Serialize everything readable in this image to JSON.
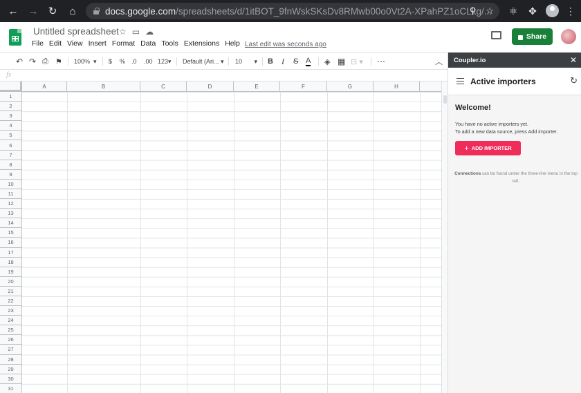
{
  "browser": {
    "url_host": "docs.google.com",
    "url_path": "/spreadsheets/d/1itBOT_9fnWskSKsDv8RMwb00o0Vt2A-XPahPZ1oCLkg/..."
  },
  "doc": {
    "title": "Untitled spreadsheet",
    "last_edit": "Last edit was seconds ago",
    "share_label": "Share"
  },
  "menu": [
    "File",
    "Edit",
    "View",
    "Insert",
    "Format",
    "Data",
    "Tools",
    "Extensions",
    "Help"
  ],
  "toolbar": {
    "zoom": "100%",
    "currency": "$",
    "percent": "%",
    "dec_decrease": ".0",
    "dec_increase": ".00",
    "number_format": "123",
    "font": "Default (Ari...",
    "font_size": "10",
    "bold": "B",
    "italic": "I",
    "strike": "S",
    "text_color": "A",
    "more": "⋯"
  },
  "formula_bar": {
    "fx": "fx"
  },
  "grid": {
    "columns": [
      "A",
      "B",
      "C",
      "D",
      "E",
      "F",
      "G",
      "H"
    ],
    "rows": [
      "1",
      "2",
      "3",
      "4",
      "5",
      "6",
      "7",
      "8",
      "9",
      "10",
      "11",
      "12",
      "13",
      "14",
      "15",
      "16",
      "17",
      "18",
      "19",
      "20",
      "21",
      "22",
      "23",
      "24",
      "25",
      "26",
      "27",
      "28",
      "29",
      "30",
      "31"
    ]
  },
  "panel": {
    "app_name": "Coupler.io",
    "close": "✕",
    "title": "Active importers",
    "welcome": "Welcome!",
    "message_line1": "You have no active importers yet.",
    "message_line2": "To add a new data source, press Add importer.",
    "add_button": "ADD IMPORTER",
    "hint_bold": "Connections",
    "hint_rest": " can be found under the three-line menu in the top left."
  },
  "colors": {
    "share_green": "#188038",
    "add_importer_red": "#f02c5a",
    "chrome_dark": "#202124",
    "panel_header": "#3c4043"
  }
}
